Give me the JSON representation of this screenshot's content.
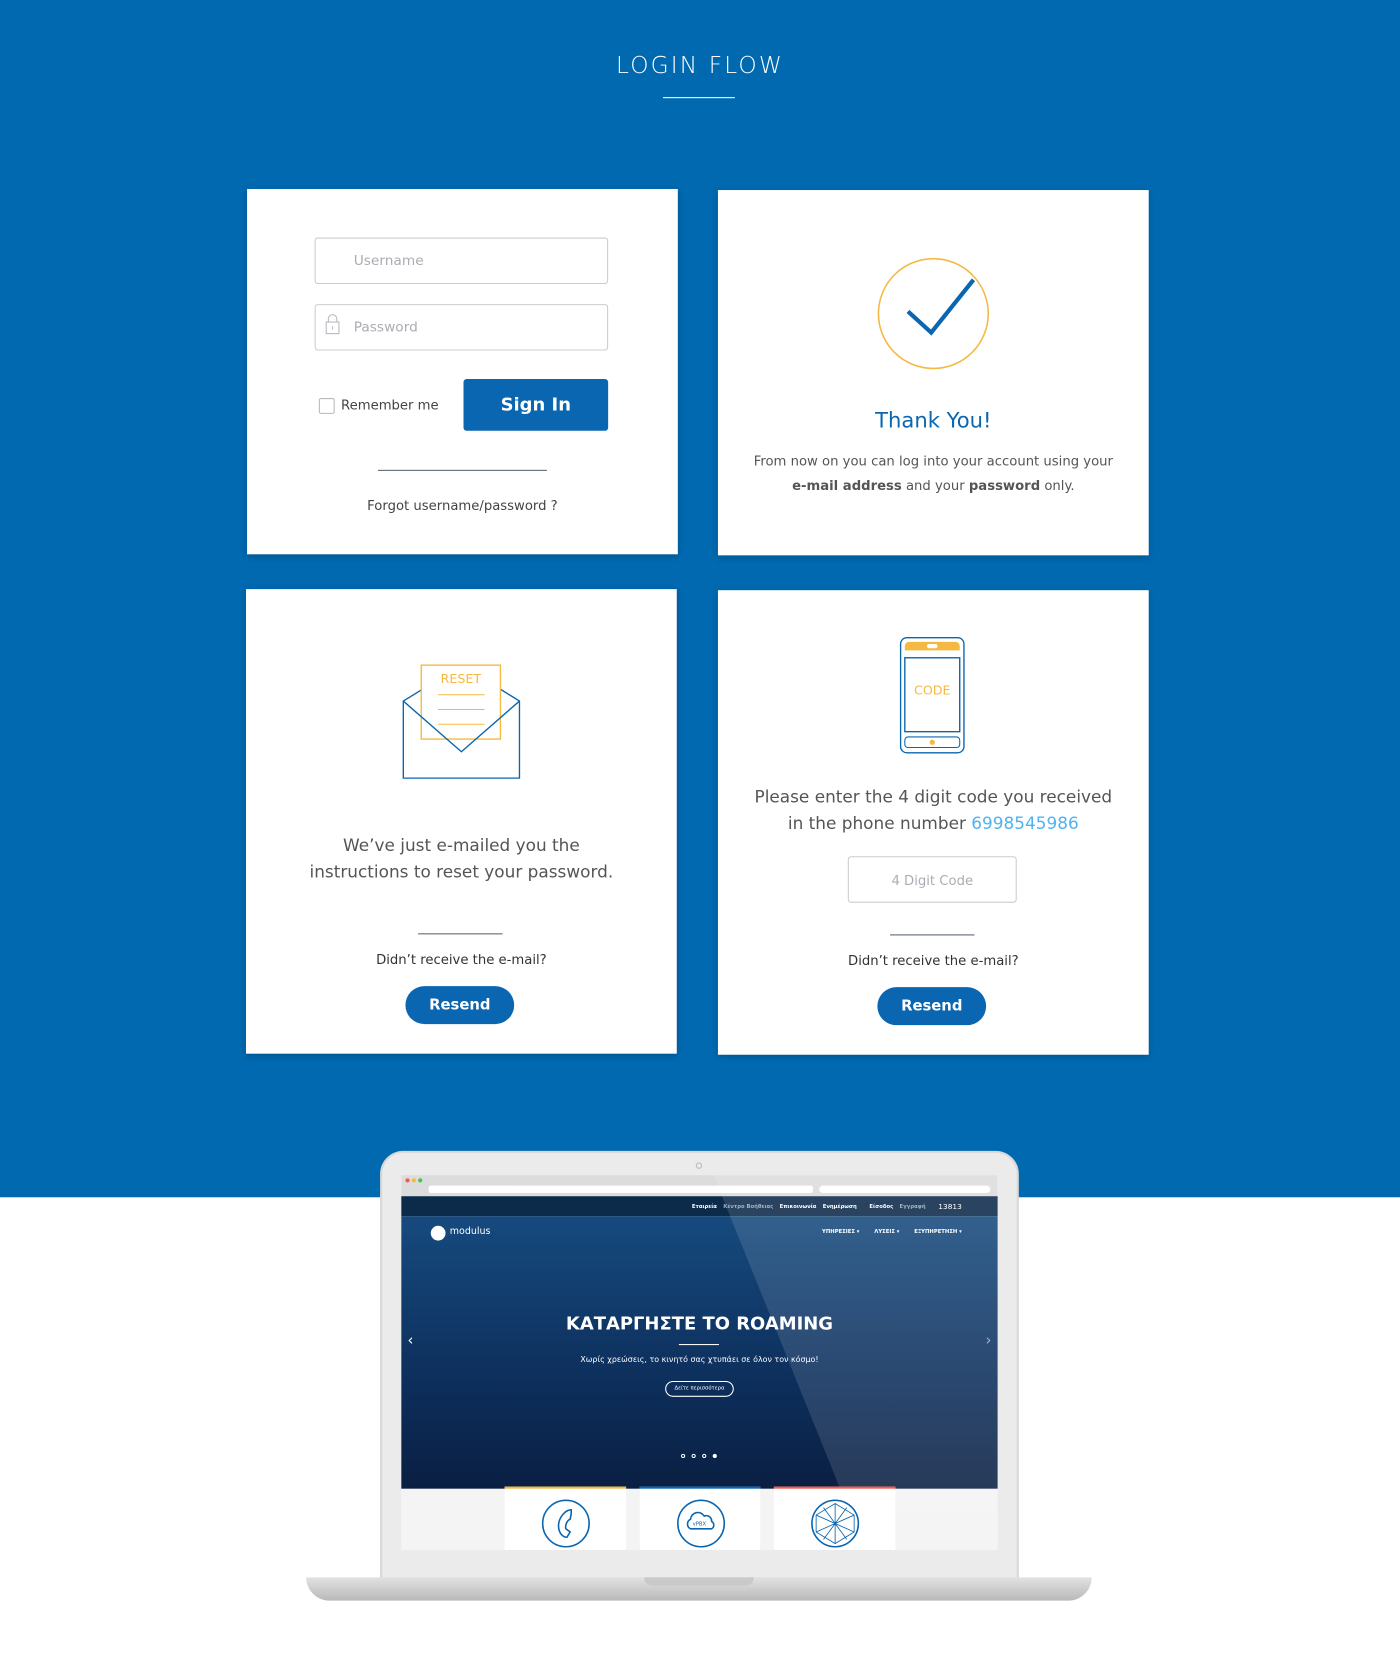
{
  "page": {
    "title": "LOGIN FLOW"
  },
  "colors": {
    "background": "#0069b0",
    "primary_button": "#0a66b0",
    "accent_orange": "#f5b942",
    "link_blue": "#4fb3f0"
  },
  "login_card": {
    "username_placeholder": "Username",
    "password_placeholder": "Password",
    "remember_label": "Remember me",
    "sign_in_label": "Sign In",
    "forgot_link": "Forgot username/password ?"
  },
  "thank_you_card": {
    "heading": "Thank You!",
    "line1": "From now on you can log into your account using your",
    "bold1": "e-mail address",
    "mid": " and your ",
    "bold2": "password",
    "end": " only."
  },
  "reset_card": {
    "envelope_label": "RESET",
    "line1": "We’ve just e-mailed you the",
    "line2": "instructions to reset your password.",
    "question": "Didn’t receive the e-mail?",
    "resend_label": "Resend"
  },
  "code_card": {
    "phone_label": "CODE",
    "line1": "Please enter the 4 digit code you received",
    "line2_prefix": "in the phone number ",
    "phone_number": "6998545986",
    "code_placeholder": "4 Digit Code",
    "question": "Didn’t receive the e-mail?",
    "resend_label": "Resend"
  },
  "laptop": {
    "top_nav": [
      "Εταιρεία",
      "Κέντρο Βοήθειας",
      "Επικοινωνία",
      "Ενημέρωση"
    ],
    "login": "Είσοδος",
    "register": "Εγγραφή",
    "phone": "13813",
    "logo": "modulus",
    "main_nav": [
      "ΥΠΗΡΕΣΙΕΣ ▾",
      "ΛΥΣΕΙΣ ▾",
      "ΕΞΥΠΗΡΕΤΗΣΗ ▾"
    ],
    "hero_title": "ΚΑΤΑΡΓΗΣΤΕ ΤΟ ROAMING",
    "hero_subtitle": "Χωρίς χρεώσεις, το κινητό σας χτυπάει σε όλον τον κόσμο!",
    "hero_button": "Δείτε περισσότερα",
    "tile_vpbx": "vPBX"
  }
}
